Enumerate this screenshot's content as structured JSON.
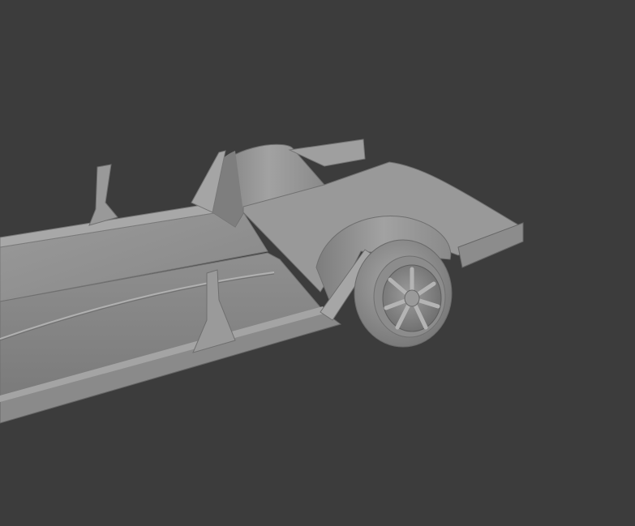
{
  "viewport": {
    "background": "#3c3c3c",
    "model_base_color": "#8e8e8e",
    "model_shadow_color": "#6a6a6a",
    "model_highlight_color": "#b4b4b4",
    "parts": [
      "chassis-floor",
      "side-sill",
      "rear-wheel-arch",
      "front-wheel-arch",
      "rear-deck",
      "b-pillar-stub",
      "c-pillar-stub",
      "rear-wheel",
      "wheel-rim"
    ]
  }
}
